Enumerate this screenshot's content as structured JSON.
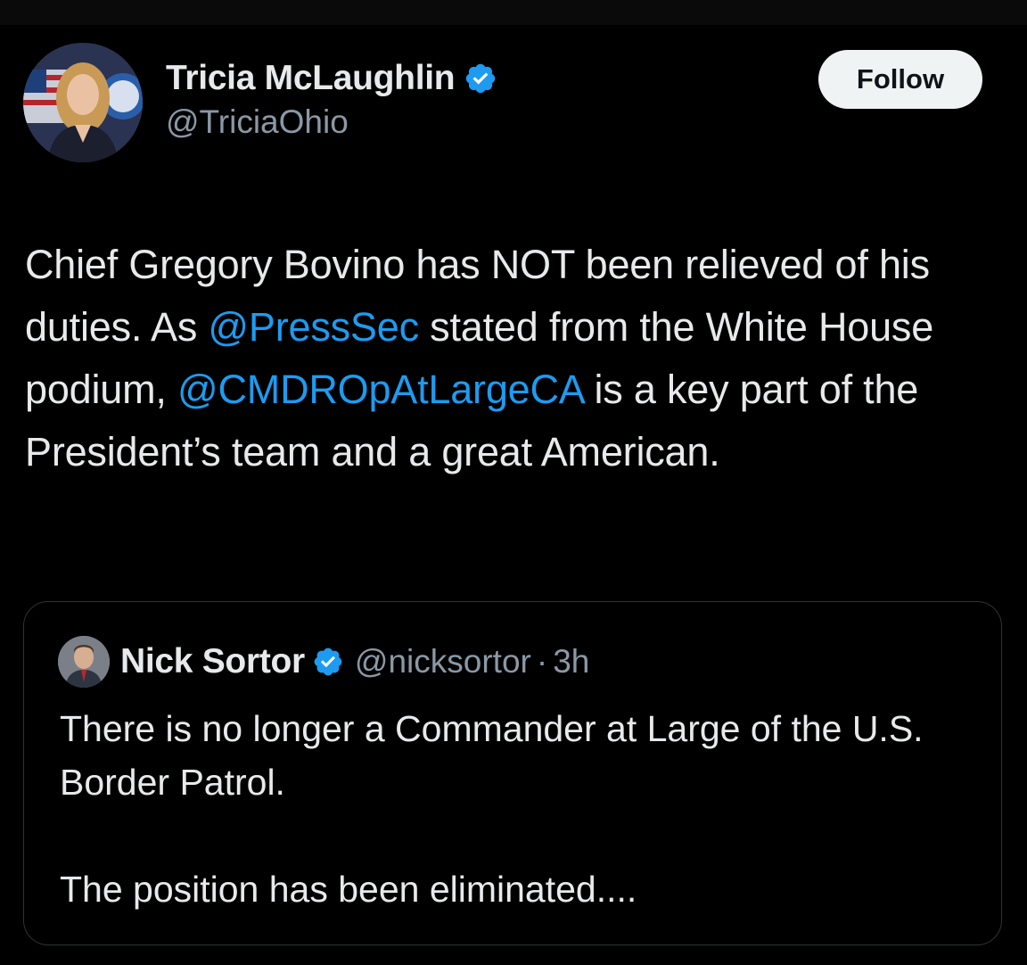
{
  "author": {
    "display_name": "Tricia McLaughlin",
    "handle": "@TriciaOhio",
    "verified_icon": "verified-badge-icon",
    "avatar_icon": "avatar-photo"
  },
  "follow_button": {
    "label": "Follow"
  },
  "tweet": {
    "part1": "Chief Gregory Bovino has NOT been relieved of his duties. As ",
    "mention1": "@PressSec",
    "part2": " stated from the White House podium, ",
    "mention2": "@CMDROpAtLargeCA",
    "part3": " is a key part of the President’s team and a great American."
  },
  "quoted_tweet": {
    "display_name": "Nick Sortor",
    "handle": "@nicksortor",
    "separator": "·",
    "time": "3h",
    "line1": "There is no longer a Commander at Large of the U.S. Border Patrol.",
    "line2": "The position has been eliminated...."
  },
  "colors": {
    "background": "#000000",
    "text": "#e7e9ea",
    "secondary": "#8b98a5",
    "mention": "#1d9bf0",
    "verified": "#1d9bf0",
    "border": "#2f3336"
  }
}
